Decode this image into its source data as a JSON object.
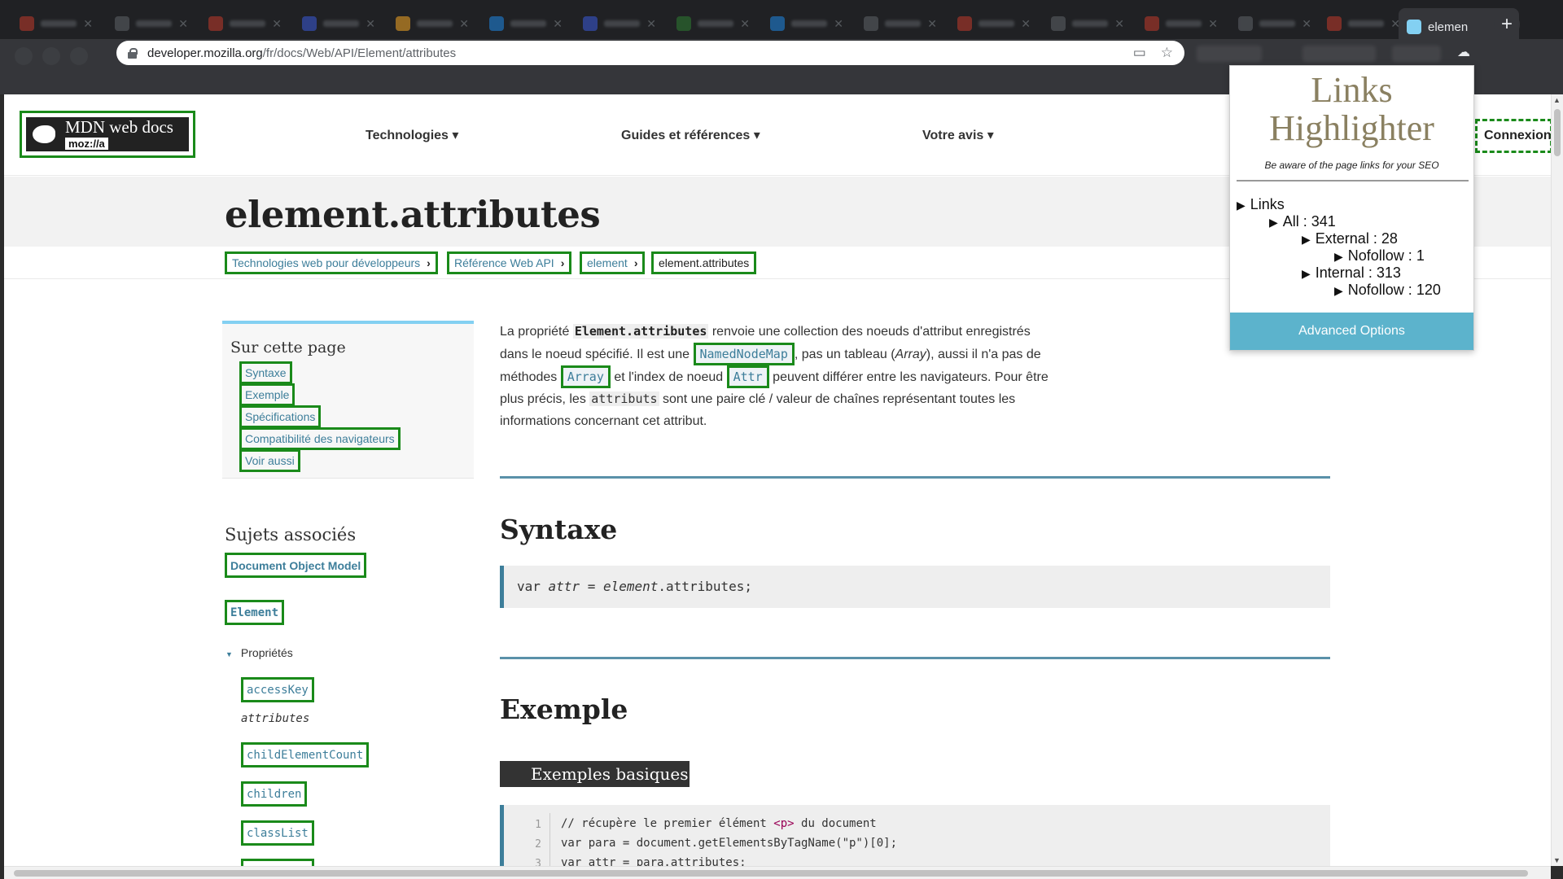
{
  "browser": {
    "active_tab": {
      "title": "elemen"
    },
    "new_tab": "+",
    "url": {
      "host": "developer.mozilla.org",
      "path": "/fr/docs/Web/API/Element/attributes"
    }
  },
  "header": {
    "logo": {
      "title": "MDN web docs",
      "brand": "moz://a"
    },
    "menu": [
      {
        "label": "Technologies ▾"
      },
      {
        "label": "Guides et références ▾"
      },
      {
        "label": "Votre avis ▾"
      }
    ],
    "login": "Connexion"
  },
  "page_title": "element.attributes",
  "breadcrumbs": [
    {
      "label": "Technologies web pour développeurs"
    },
    {
      "label": "Référence Web API"
    },
    {
      "label": "element"
    },
    {
      "label": "element.attributes"
    }
  ],
  "toc": {
    "heading": "Sur cette page",
    "items": [
      "Syntaxe",
      "Exemple",
      "Spécifications",
      "Compatibilité des navigateurs",
      "Voir aussi"
    ]
  },
  "related": {
    "heading": "Sujets associés",
    "dom": "Document Object Model",
    "element": "Element",
    "properties_label": "Propriétés",
    "properties": [
      "accessKey",
      "attributes",
      "childElementCount",
      "children",
      "classList"
    ]
  },
  "intro": {
    "p1": "La propriété ",
    "c1": "Element.attributes",
    "p2": " renvoie une collection des noeuds d'attribut enregistrés dans le noeud spécifié. Il est une ",
    "c2": "NamedNodeMap",
    "p3": ", pas un tableau (",
    "i1": "Array",
    "p4": "), aussi il n'a pas de méthodes ",
    "c3": "Array",
    "p5": " et l'index de noeud ",
    "c4": "Attr",
    "p6": " peuvent différer entre les navigateurs. Pour être plus précis, les ",
    "c5": "attributs",
    "p7": " sont une paire clé / valeur de chaînes représentant toutes les informations concernant cet attribut."
  },
  "syntax": {
    "heading": "Syntaxe",
    "code_a": "var ",
    "code_b": "attr",
    "code_c": " = ",
    "code_d": "element",
    "code_e": ".attributes;"
  },
  "example": {
    "heading": "Exemple",
    "subheading": "Exemples basiques",
    "line_numbers": [
      "1",
      "2",
      "3"
    ],
    "line1_a": "// récupère le premier élément ",
    "line1_tag": "<p>",
    "line1_b": " du document",
    "line2": "var para = document.getElementsByTagName(\"p\")[0];",
    "line3": "var attr = para.attributes;"
  },
  "extension": {
    "title": "Links Highlighter",
    "subtitle": "Be aware of the page links for your SEO",
    "links": "Links",
    "all": "All : 341",
    "external": "External : 28",
    "external_nofollow": "Nofollow : 1",
    "internal": "Internal : 313",
    "internal_nofollow": "Nofollow : 120",
    "advanced": "Advanced Options"
  },
  "colors": {
    "highlight_outline": "#1a8a1a",
    "link": "#3d7e9a",
    "popup_button": "#5cb3cc",
    "popup_title": "#8a8061"
  }
}
